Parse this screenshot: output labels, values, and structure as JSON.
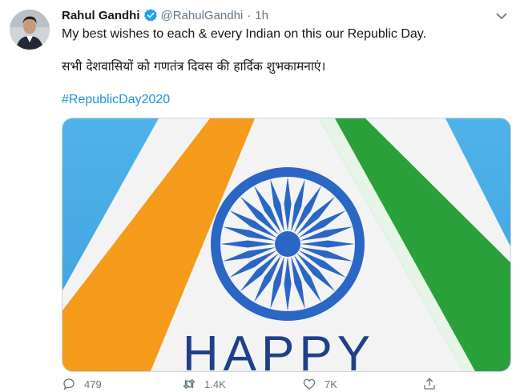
{
  "tweet": {
    "display_name": "Rahul Gandhi",
    "handle": "@RahulGandhi",
    "separator": "·",
    "time": "1h",
    "text_en": "My best wishes to each & every Indian on this our Republic Day.",
    "text_hi": "सभी देशवासियों को गणतंत्र दिवस की हार्दिक शुभकामनाएं।",
    "hashtag": "#RepublicDay2020",
    "image_text": "HAPPY",
    "actions": {
      "reply_count": "479",
      "retweet_count": "1.4K",
      "like_count": "7K"
    }
  },
  "icons": {
    "verified": "verified-badge-icon",
    "menu": "chevron-down-icon",
    "reply": "reply-icon",
    "retweet": "retweet-icon",
    "like": "heart-icon",
    "share": "share-icon"
  },
  "colors": {
    "accent": "#1b95e0",
    "secondary_text": "#657786",
    "saffron": "#f69a1c",
    "green": "#2aa03a",
    "chakra": "#2a66c4",
    "sky": "#49aee7"
  }
}
